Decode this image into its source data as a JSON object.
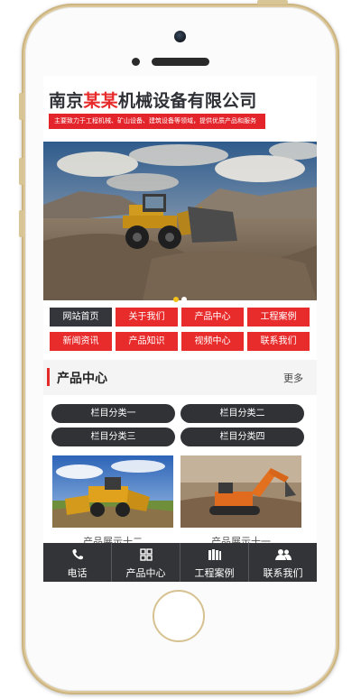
{
  "site": {
    "title_part1": "南京",
    "title_part2": "某某",
    "title_part3": "机械设备有限公司",
    "tagline": "主要致力于工程机械、矿山设备、建筑设备等领域，提供优质产品和服务",
    "brand_red": "#e3242b",
    "dark": "#323437"
  },
  "banner": {
    "dots": [
      "active",
      "inactive"
    ]
  },
  "nav": [
    {
      "label": "网站首页",
      "active": true
    },
    {
      "label": "关于我们",
      "active": false
    },
    {
      "label": "产品中心",
      "active": false
    },
    {
      "label": "工程案例",
      "active": false
    },
    {
      "label": "新闻资讯",
      "active": false
    },
    {
      "label": "产品知识",
      "active": false
    },
    {
      "label": "视频中心",
      "active": false
    },
    {
      "label": "联系我们",
      "active": false
    }
  ],
  "section": {
    "title": "产品中心",
    "more": "更多"
  },
  "categories": [
    "栏目分类一",
    "栏目分类二",
    "栏目分类三",
    "栏目分类四"
  ],
  "products": [
    {
      "name": "产品展示十二",
      "icon": "loader-photo"
    },
    {
      "name": "产品展示十一",
      "icon": "excavator-photo"
    }
  ],
  "bottom_tabs": [
    {
      "label": "电话",
      "icon": "phone-icon"
    },
    {
      "label": "产品中心",
      "icon": "grid-icon"
    },
    {
      "label": "工程案例",
      "icon": "books-icon"
    },
    {
      "label": "联系我们",
      "icon": "users-icon"
    }
  ]
}
